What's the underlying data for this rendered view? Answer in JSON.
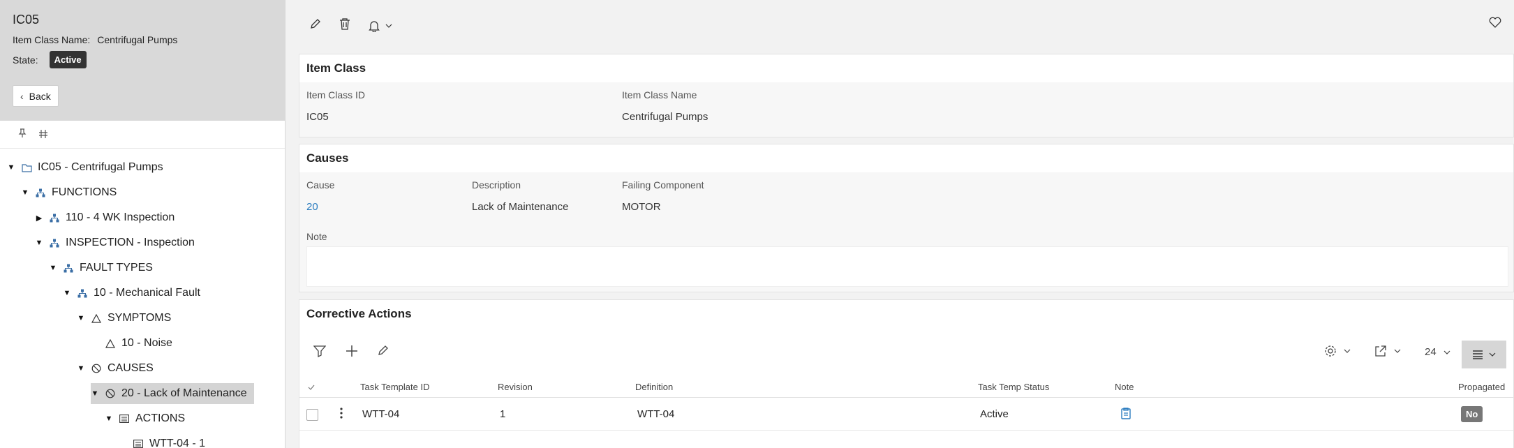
{
  "header": {
    "record_id": "IC05",
    "item_class_name_label": "Item Class Name:",
    "item_class_name_value": "Centrifugal Pumps",
    "state_label": "State:",
    "state_value": "Active",
    "back_label": "Back"
  },
  "tree": [
    {
      "label": "IC05 - Centrifugal Pumps",
      "icon": "folder-icon",
      "toggle": "expanded"
    },
    {
      "label": "FUNCTIONS",
      "icon": "hierarchy-icon",
      "toggle": "expanded"
    },
    {
      "label": "110 - 4 WK Inspection",
      "icon": "hierarchy-icon",
      "toggle": "collapsed"
    },
    {
      "label": "INSPECTION - Inspection",
      "icon": "hierarchy-icon",
      "toggle": "expanded"
    },
    {
      "label": "FAULT TYPES",
      "icon": "hierarchy-icon",
      "toggle": "expanded"
    },
    {
      "label": "10 - Mechanical Fault",
      "icon": "hierarchy-icon",
      "toggle": "expanded"
    },
    {
      "label": "SYMPTOMS",
      "icon": "triangle-icon",
      "toggle": "expanded"
    },
    {
      "label": "10 - Noise",
      "icon": "triangle-icon",
      "toggle": "none"
    },
    {
      "label": "CAUSES",
      "icon": "no-entry-icon",
      "toggle": "expanded"
    },
    {
      "label": "20 - Lack of Maintenance",
      "icon": "no-entry-icon",
      "toggle": "expanded",
      "selected": true
    },
    {
      "label": "ACTIONS",
      "icon": "list-icon",
      "toggle": "expanded"
    },
    {
      "label": "WTT-04 - 1",
      "icon": "list-icon",
      "toggle": "none"
    }
  ],
  "item_class": {
    "title": "Item Class",
    "id_label": "Item Class ID",
    "id_value": "IC05",
    "name_label": "Item Class Name",
    "name_value": "Centrifugal Pumps"
  },
  "causes": {
    "title": "Causes",
    "cause_label": "Cause",
    "cause_value": "20",
    "description_label": "Description",
    "description_value": "Lack of Maintenance",
    "failing_component_label": "Failing Component",
    "failing_component_value": "MOTOR",
    "note_label": "Note"
  },
  "corrective_actions": {
    "title": "Corrective Actions",
    "page_size": "24",
    "columns": [
      "Task Template ID",
      "Revision",
      "Definition",
      "Task Temp Status",
      "Note",
      "Propagated"
    ],
    "rows": [
      {
        "task_template_id": "WTT-04",
        "revision": "1",
        "definition": "WTT-04",
        "status": "Active",
        "propagated": "No"
      }
    ]
  },
  "colors": {
    "link": "#2a7cbf",
    "header_bg": "#d9d9d9",
    "state_badge": "#333333",
    "propagated_badge": "#777777"
  }
}
